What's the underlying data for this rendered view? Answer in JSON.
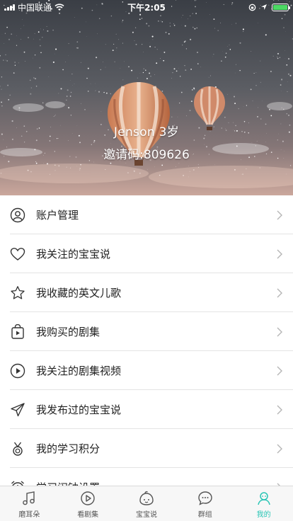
{
  "status_bar": {
    "carrier": "中国联通",
    "time": "下午2:05",
    "battery_level": 1.0
  },
  "profile": {
    "name": "Jenson 3岁",
    "invite_code": "邀请码:809626"
  },
  "menu": {
    "items": [
      {
        "label": "账户管理",
        "icon": "user-circle-icon"
      },
      {
        "label": "我关注的宝宝说",
        "icon": "heart-icon"
      },
      {
        "label": "我收藏的英文儿歌",
        "icon": "star-icon"
      },
      {
        "label": "我购买的剧集",
        "icon": "play-bag-icon"
      },
      {
        "label": "我关注的剧集视频",
        "icon": "play-circle-icon"
      },
      {
        "label": "我发布过的宝宝说",
        "icon": "paper-plane-icon"
      },
      {
        "label": "我的学习积分",
        "icon": "medal-icon"
      },
      {
        "label": "学习闹钟设置",
        "icon": "alarm-clock-icon"
      }
    ]
  },
  "tabbar": {
    "active_color": "#29c5b5",
    "tabs": [
      {
        "label": "磨耳朵",
        "icon": "music-note-icon"
      },
      {
        "label": "看剧集",
        "icon": "play-circle-icon"
      },
      {
        "label": "宝宝说",
        "icon": "baby-face-icon"
      },
      {
        "label": "群组",
        "icon": "chat-bubble-icon"
      },
      {
        "label": "我的",
        "icon": "user-icon",
        "active": true
      }
    ]
  }
}
